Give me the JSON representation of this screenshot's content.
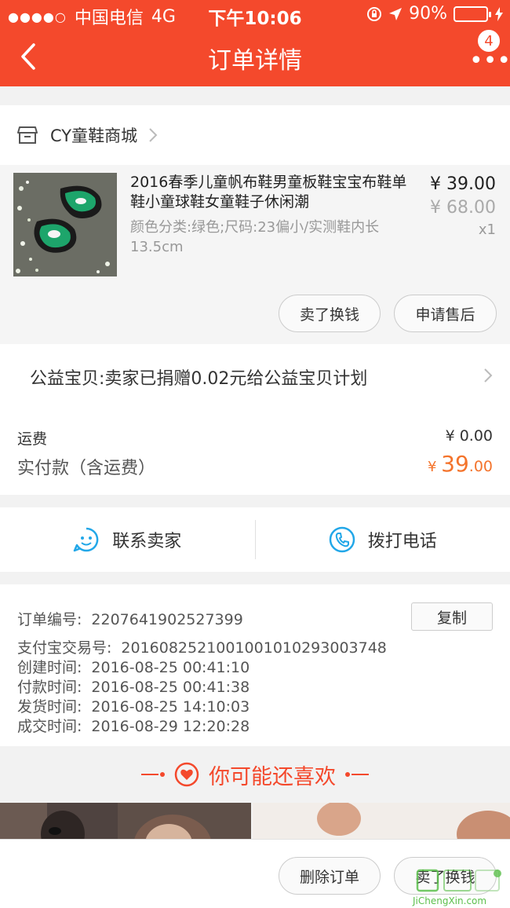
{
  "statusbar": {
    "signal": "●●●●○",
    "carrier": "中国电信",
    "network": "4G",
    "time": "下午10:06",
    "battery": "90%"
  },
  "navbar": {
    "title": "订单详情",
    "badge_count": "4"
  },
  "shop": {
    "name": "CY童鞋商城"
  },
  "product": {
    "title": "2016春季儿童帆布鞋男童板鞋宝宝布鞋单鞋小童球鞋女童鞋子休闲潮",
    "spec": "颜色分类:绿色;尺码:23偏小/实测鞋内长13.5cm",
    "price": "¥ 39.00",
    "original_price": "¥ 68.00",
    "quantity": "x1",
    "buttons": {
      "sell": "卖了换钱",
      "after_sale": "申请售后"
    }
  },
  "charity": {
    "text": "公益宝贝:卖家已捐赠0.02元给公益宝贝计划"
  },
  "fees": {
    "shipping_label": "运费",
    "shipping_value": "¥ 0.00",
    "paid_label": "实付款（含运费）",
    "paid_currency": "¥ ",
    "paid_integer": "39",
    "paid_decimal": ".00"
  },
  "contact": {
    "seller": "联系卖家",
    "phone": "拨打电话"
  },
  "order_info": {
    "order_no_label": "订单编号:",
    "order_no": "2207641902527399",
    "copy": "复制",
    "alipay_label": "支付宝交易号:",
    "alipay_no": "2016082521001001010293003748",
    "created_label": "创建时间:",
    "created": "2016-08-25 00:41:10",
    "paid_label": "付款时间:",
    "paid": "2016-08-25 00:41:38",
    "shipped_label": "发货时间:",
    "shipped": "2016-08-25 14:10:03",
    "completed_label": "成交时间:",
    "completed": "2016-08-29 12:20:28"
  },
  "recommend": {
    "title": "你可能还喜欢"
  },
  "bottom_bar": {
    "delete": "删除订单",
    "sell": "卖了换钱"
  },
  "watermark": {
    "text": "JiChengXin.com"
  },
  "colors": {
    "brand": "#f4492c",
    "price_accent": "#f4742c",
    "contact_icon": "#22a7e8"
  }
}
